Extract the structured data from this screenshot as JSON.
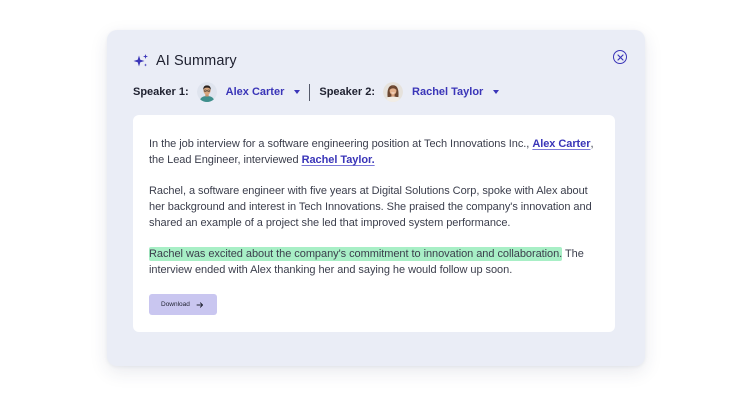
{
  "header": {
    "title": "AI Summary",
    "icon": "sparkle-icon",
    "accent_color": "#3a35b8"
  },
  "close": {
    "icon": "close-circle-icon"
  },
  "speakers": [
    {
      "label": "Speaker 1:",
      "name": "Alex Carter",
      "avatar": "avatar-male"
    },
    {
      "label": "Speaker 2:",
      "name": "Rachel Taylor",
      "avatar": "avatar-female"
    }
  ],
  "summary": {
    "p1": {
      "before": "In the job interview for a software engineering position at Tech Innovations Inc., ",
      "link1": "Alex Carter",
      "middle": ", the Lead Engineer, interviewed ",
      "link2": "Rachel Taylor."
    },
    "p2": "Rachel, a software engineer with five years at Digital Solutions Corp, spoke with Alex about her background and interest in Tech Innovations. She praised the company's innovation and shared an example of a project she led that improved system performance.",
    "p3": {
      "highlighted": "Rachel was excited about the company's commitment to innovation and collaboration.",
      "rest": " The interview ended with Alex thanking her and saying he would follow up soon.",
      "highlight_color": "#a8efc6"
    }
  },
  "download": {
    "label": "Download",
    "icon": "arrow-right-icon",
    "bg_color": "#c9c6f0"
  },
  "colors": {
    "panel_bg": "#eaedf6",
    "card_bg": "#ffffff",
    "link": "#3a35b8"
  }
}
